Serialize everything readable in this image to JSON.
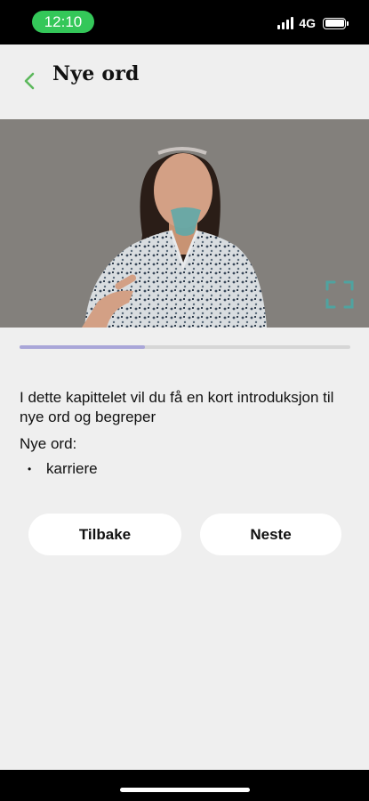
{
  "status_bar": {
    "time": "12:10",
    "network": "4G",
    "icons": [
      "cellular-signal-icon",
      "battery-icon"
    ]
  },
  "header": {
    "back_icon": "chevron-left-icon",
    "title": "Nye ord"
  },
  "video": {
    "fullscreen_icon": "fullscreen-icon"
  },
  "progress": {
    "value": 0.38
  },
  "content": {
    "intro": "I dette kapittelet vil du få en kort introduksjon til nye ord og begreper",
    "words_heading": "Nye ord:",
    "words": [
      "karriere"
    ]
  },
  "buttons": {
    "back_label": "Tilbake",
    "next_label": "Neste"
  },
  "colors": {
    "accent_green": "#5cb85c",
    "time_pill": "#34c759",
    "progress_fill": "#a9a6d8",
    "fullscreen_teal": "#4fa3a0"
  }
}
